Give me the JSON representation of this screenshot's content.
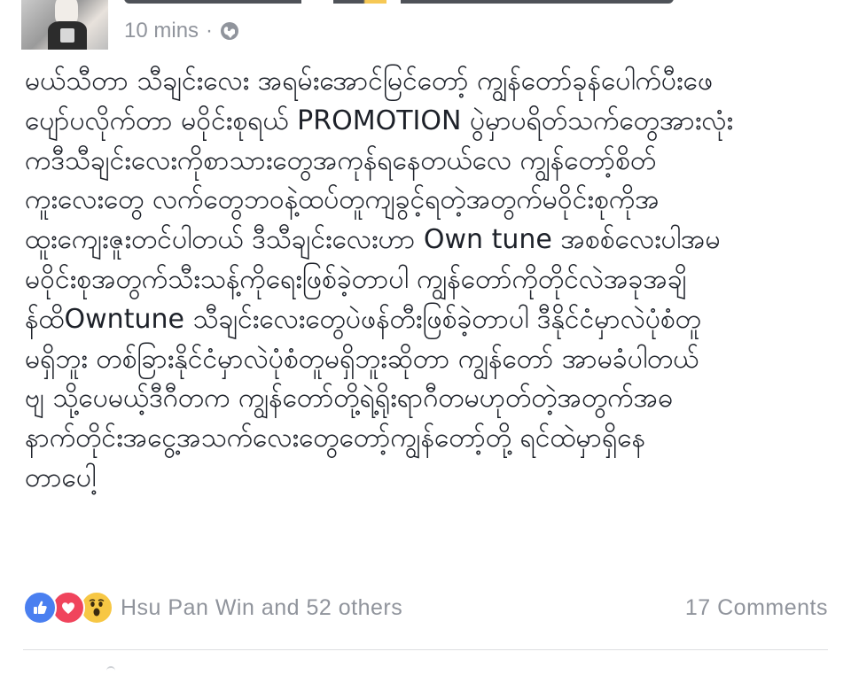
{
  "post": {
    "timestamp": "10 mins",
    "separator": "·",
    "privacy_icon": "globe-icon",
    "body_lines": [
      "မယ်သီတာ သီချင်းလေး အရမ်းအောင်မြင်တော့် ကျွန်တော်ခုန်ပေါက်ပီးဖေ",
      "ပျော်ပလိုက်တာ မဝိုင်းစုရယ် PROMOTION ပွဲမှာပရိတ်သက်တွေအားလုံး",
      "ကဒီသီချင်းလေးကိုစာသားတွေအကုန်ရနေတယ်လေ ကျွန်တော့်စိတ်",
      "ကူးလေးတွေ လက်တွေဘဝနဲ့ထပ်တူကျခွင့်ရတဲ့အတွက်မဝိုင်းစုကိုအ",
      "ထူးကျေးဇူးတင်ပါတယ် ဒီသီချင်းလေးဟာ  Own tune အစစ်လေးပါအမ",
      "မဝိုင်းစုအတွက်သီးသန့်ကိုရေးဖြစ်ခဲ့တာပါ ကျွန်တော်ကိုတိုင်လဲအခုအချိ",
      "န်ထိOwntune သီချင်းလေးတွေပဲဖန်တီးဖြစ်ခဲ့တာပါ ဒီနိုင်ငံမှာလဲပုံစံတူ",
      "မရှိဘူး တစ်ခြားနိုင်ငံမှာလဲပုံစံတူမရှိဘူးဆိုတာ ကျွန်တော် အာမခံပါတယ်",
      "ဗျ သို့ပေမယ့်ဒီဂီတက ကျွန်တော်တို့ရဲ့ရိုးရာဂီတမဟုတ်တဲ့အတွက်အဓ",
      "နာက်တိုင်းအငွေ့အသက်လေးတွေတော့်ကျွန်တော့်တို့ ရင်ထဲမှာရှိနေ",
      "တာပေါ့"
    ]
  },
  "reactions": {
    "icons": [
      "like-icon",
      "love-icon",
      "wow-icon"
    ],
    "summary": "Hsu Pan Win and 52 others",
    "comments": "17 Comments"
  },
  "colors": {
    "text": "#1d2129",
    "meta": "#90949c",
    "like": "#4a7ff0",
    "love": "#f0445c",
    "wow": "#f7c744",
    "divider": "#dddfe2"
  }
}
